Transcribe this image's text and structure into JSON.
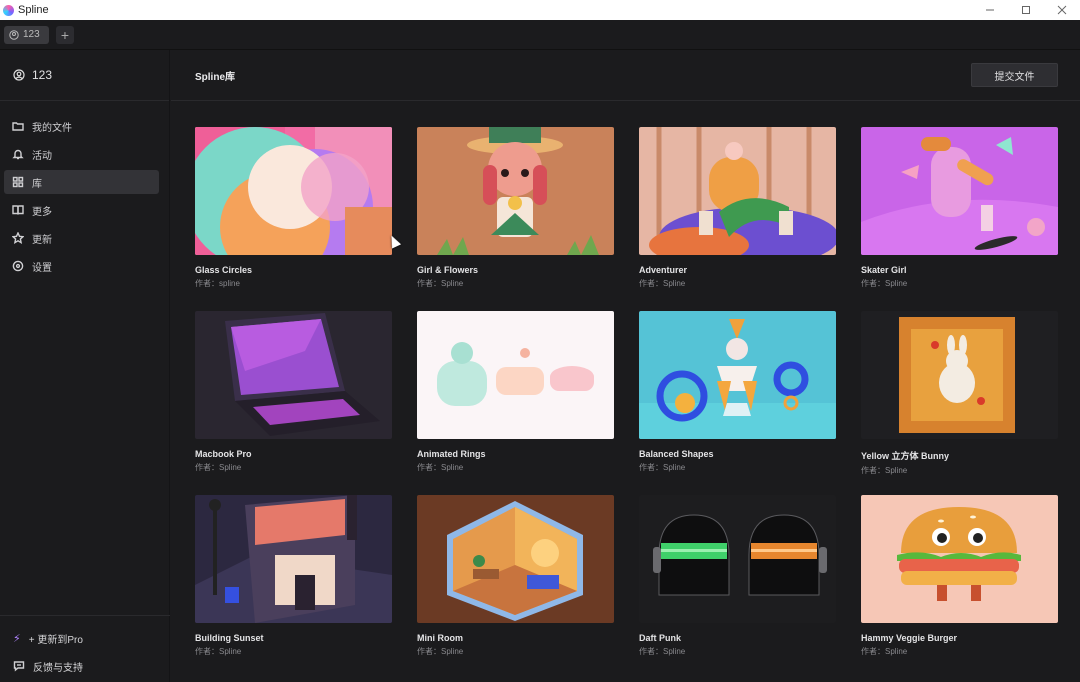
{
  "window": {
    "app_title": "Spline"
  },
  "tabs": {
    "user_chip": "123",
    "add_label": "+"
  },
  "sidebar": {
    "username": "123",
    "items": [
      {
        "label": "我的文件",
        "icon": "folder-icon",
        "active": false
      },
      {
        "label": "活动",
        "icon": "bell-icon",
        "active": false
      },
      {
        "label": "库",
        "icon": "grid-icon",
        "active": true
      },
      {
        "label": "更多",
        "icon": "book-icon",
        "active": false
      },
      {
        "label": "更新",
        "icon": "star-icon",
        "active": false
      },
      {
        "label": "设置",
        "icon": "settings-icon",
        "active": false
      }
    ],
    "upgrade_label": "+ 更新到Pro",
    "feedback_label": "反馈与支持"
  },
  "header": {
    "title": "Spline库",
    "submit_label": "提交文件"
  },
  "library": [
    {
      "title": "Glass Circles",
      "author": "作者：spline"
    },
    {
      "title": "Girl & Flowers",
      "author": "作者：Spline"
    },
    {
      "title": "Adventurer",
      "author": "作者：Spline"
    },
    {
      "title": "Skater Girl",
      "author": "作者：Spline"
    },
    {
      "title": "Macbook Pro",
      "author": "作者：Spline"
    },
    {
      "title": "Animated Rings",
      "author": "作者：Spline"
    },
    {
      "title": "Balanced Shapes",
      "author": "作者：Spline"
    },
    {
      "title": "Yellow 立方体 Bunny",
      "author": "作者：Spline"
    },
    {
      "title": "Building Sunset",
      "author": "作者：Spline"
    },
    {
      "title": "Mini Room",
      "author": "作者：Spline"
    },
    {
      "title": "Daft Punk",
      "author": "作者：Spline"
    },
    {
      "title": "Hammy Veggie Burger",
      "author": "作者：Spline"
    }
  ],
  "colors": {
    "background": "#1b1b1d",
    "active_nav": "#333337",
    "accent_pro": "#b084ff"
  }
}
